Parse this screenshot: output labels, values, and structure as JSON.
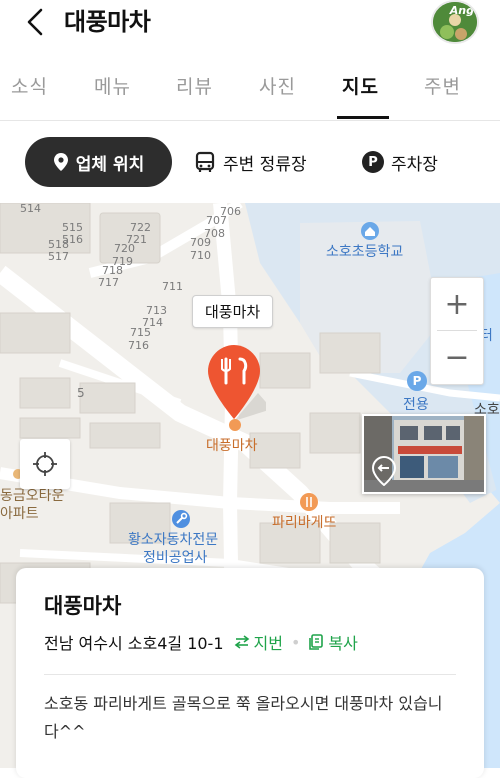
{
  "header": {
    "title": "대풍마차",
    "avatar_label": "Ang"
  },
  "tabs": [
    {
      "label": "소식"
    },
    {
      "label": "메뉴"
    },
    {
      "label": "리뷰"
    },
    {
      "label": "사진"
    },
    {
      "label": "지도",
      "active": true
    },
    {
      "label": "주변"
    }
  ],
  "subtabs": {
    "location": "업체 위치",
    "bus_stop": "주변 정류장",
    "parking": "주차장",
    "parking_icon_letter": "P"
  },
  "map": {
    "lots": [
      "514",
      "515",
      "516",
      "518",
      "517",
      "722",
      "721",
      "720",
      "719",
      "718",
      "717",
      "706",
      "707",
      "708",
      "709",
      "710",
      "711",
      "713",
      "714",
      "715",
      "716",
      "5"
    ],
    "school": "소호초등학교",
    "parking_label": "전용",
    "edge_right_top": "터",
    "edge_right": "소호",
    "apt_line1": "동금오타운",
    "apt_line2": "아파트",
    "repair_line1": "황소자동차전문",
    "repair_line2": "정비공업사",
    "bakery": "파리바게뜨",
    "place_marker_label": "대풍마차",
    "tooltip": "대풍마차",
    "zoom_in": "+",
    "zoom_out": "−",
    "parking_poi_letter": "P"
  },
  "card": {
    "title": "대풍마차",
    "address": "전남 여수시 소호4길 10-1",
    "jibun_label": "지번",
    "copy_label": "복사",
    "description": "소호동 파리바게트 골목으로 쭉 올라오시면 대풍마차 있습니다^^"
  },
  "colors": {
    "accent_green": "#1fa34a",
    "marker_red": "#ee5531",
    "water": "#cfe6fb",
    "chip_dark": "#2d2d2d"
  }
}
